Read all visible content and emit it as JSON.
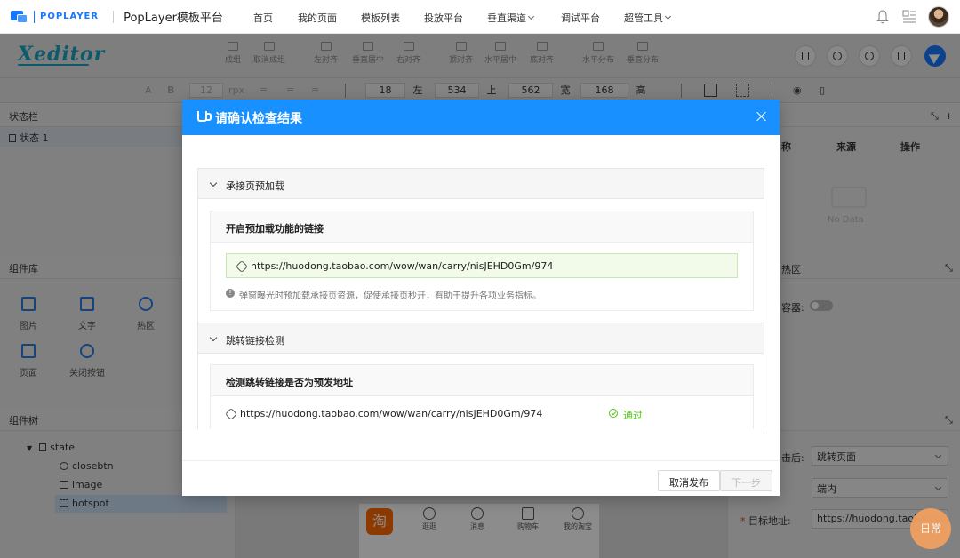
{
  "topnav": {
    "brand": "POPLAYER",
    "platform": "PopLayer模板平台",
    "items": [
      "首页",
      "我的页面",
      "模板列表",
      "投放平台",
      "垂直渠道",
      "调试平台",
      "超管工具"
    ]
  },
  "toolbar": {
    "logo": "Xeditor",
    "tools": [
      "成组",
      "取消成组",
      "左对齐",
      "垂直居中",
      "右对齐",
      "顶对齐",
      "水平居中",
      "底对齐",
      "水平分布",
      "垂直分布"
    ]
  },
  "propbar": {
    "font_size": "12",
    "font_unit": "rpx",
    "x": "18",
    "x_label": "左",
    "y": "534",
    "y_label": "上",
    "w": "562",
    "w_label": "宽",
    "h": "168",
    "h_label": "高"
  },
  "left": {
    "status_title": "状态栏",
    "state_item": "状态 1",
    "lib_title": "组件库",
    "components": [
      "图片",
      "文字",
      "热区",
      "页面",
      "关闭按钮"
    ],
    "tree_title": "组件树",
    "tree": [
      "state",
      "closebtn",
      "image",
      "hotspot"
    ]
  },
  "canvas": {
    "tabs": [
      "逛逛",
      "消息",
      "购物车",
      "我的淘宝"
    ],
    "taobao": "淘"
  },
  "right": {
    "col_name_fragment": "称",
    "col_source": "来源",
    "col_action": "操作",
    "no_data": "No Data",
    "hot_title_fragment": "热区",
    "container_label_fragment": "容器:",
    "after_click_label_fragment": "击后:",
    "after_click_value": "跳转页面",
    "scope_value": "端内",
    "target_label": "目标地址:",
    "target_value": "https://huodong.taobao.com/v",
    "daily": "日常"
  },
  "modal": {
    "title": "请确认检查结果",
    "section1": {
      "title": "承接页预加载",
      "card_title": "开启预加载功能的链接",
      "url": "https://huodong.taobao.com/wow/wan/carry/nisJEHD0Gm/974",
      "hint": "弹窗曝光时预加载承接页资源，促使承接页秒开，有助于提升各项业务指标。"
    },
    "section2": {
      "title": "跳转链接检测",
      "card_title": "检测跳转链接是否为预发地址",
      "url": "https://huodong.taobao.com/wow/wan/carry/nisJEHD0Gm/974",
      "status": "通过"
    },
    "cancel": "取消发布",
    "next": "下一步"
  }
}
